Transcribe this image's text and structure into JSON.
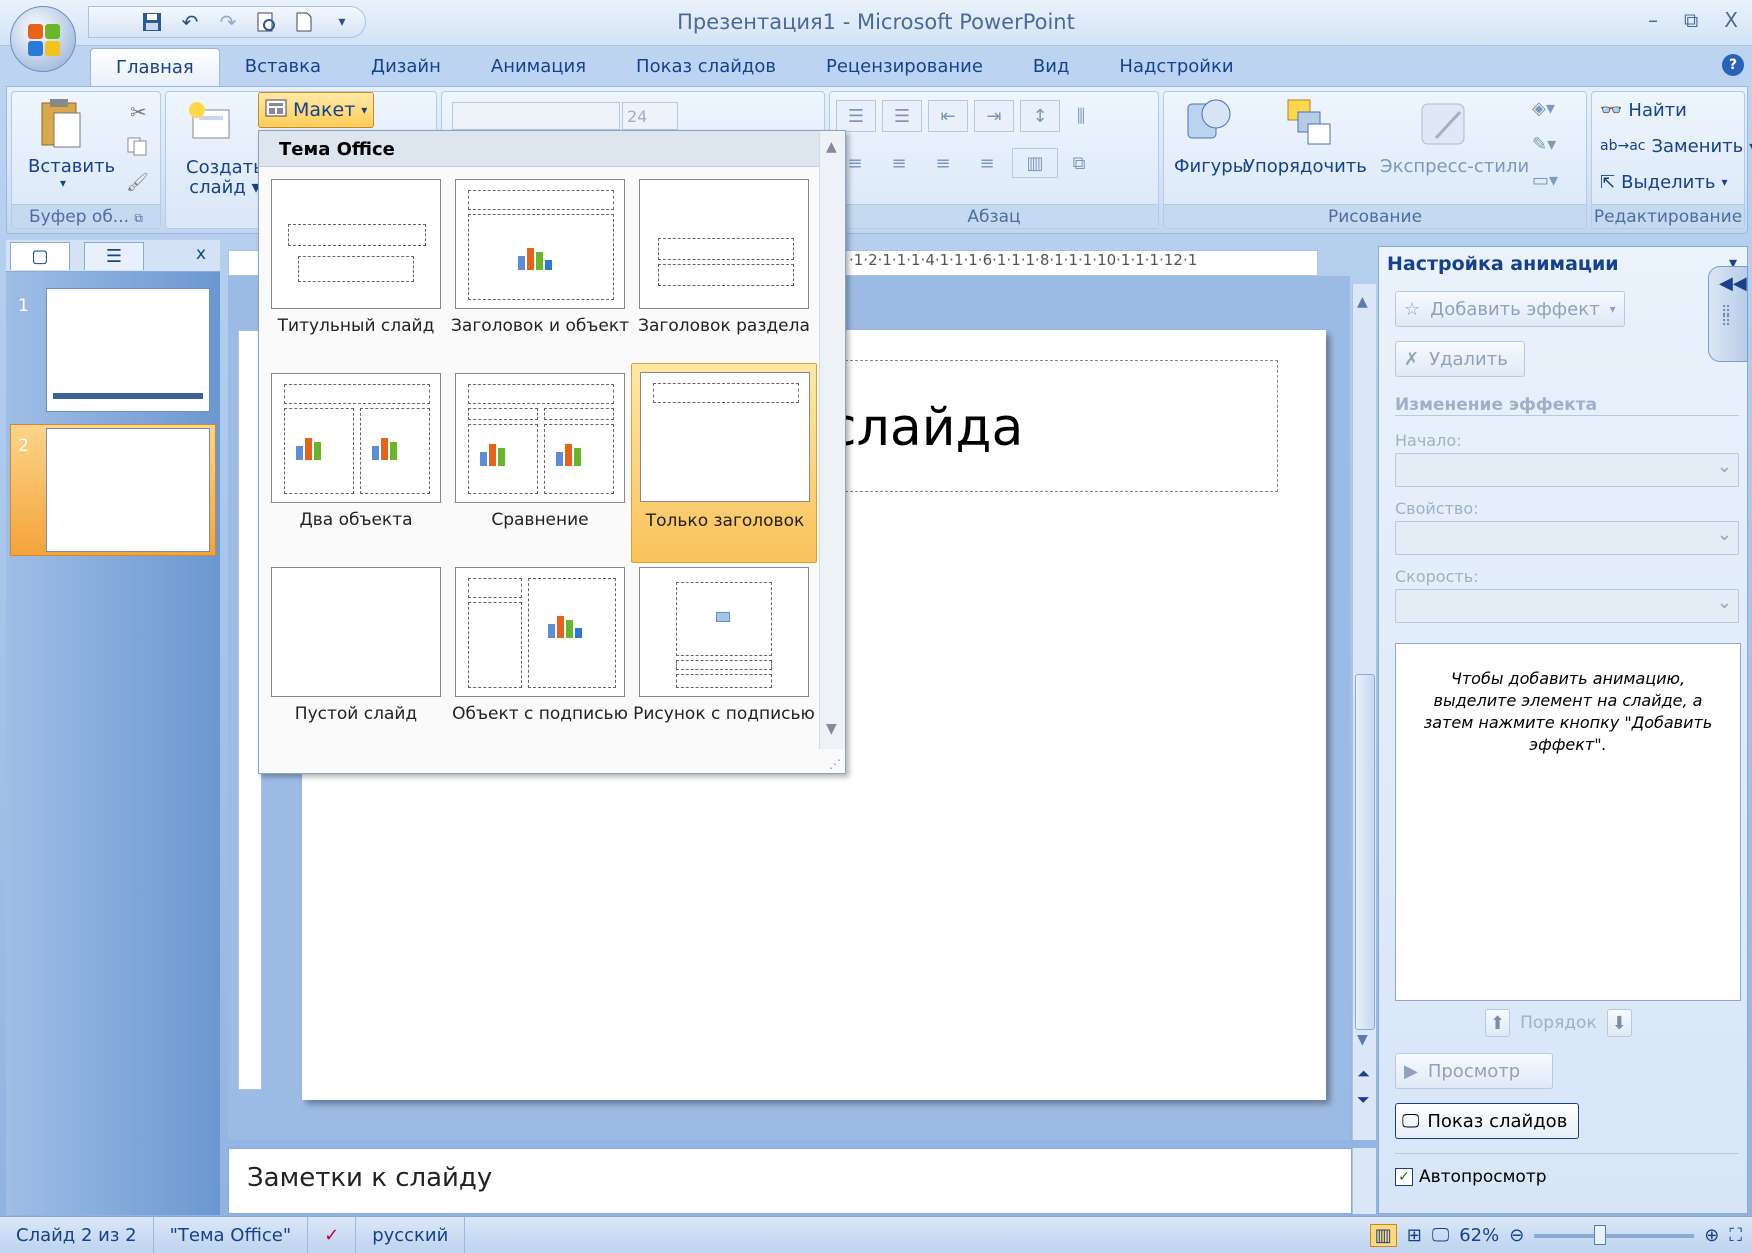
{
  "window": {
    "title": "Презентация1 - Microsoft PowerPoint",
    "min": "–",
    "max": "⧉",
    "close": "X"
  },
  "tabs": [
    "Главная",
    "Вставка",
    "Дизайн",
    "Анимация",
    "Показ слайдов",
    "Рецензирование",
    "Вид",
    "Надстройки"
  ],
  "ribbon": {
    "clipboard": {
      "paste": "Вставить",
      "label": "Буфер об..."
    },
    "slides": {
      "new_slide_1": "Создать",
      "new_slide_2": "слайд",
      "layout": "Макет"
    },
    "font_size": "24",
    "paragraph_label": "Абзац",
    "drawing": {
      "shapes": "Фигуры",
      "arrange": "Упорядочить",
      "quick_styles": "Экспресс-стили",
      "label": "Рисование"
    },
    "editing": {
      "find": "Найти",
      "replace": "Заменить",
      "select": "Выделить",
      "label": "Редактирование"
    }
  },
  "layout_gallery": {
    "header": "Тема Office",
    "items": [
      {
        "label": "Титульный слайд",
        "selected": false
      },
      {
        "label": "Заголовок и объект",
        "selected": false
      },
      {
        "label": "Заголовок раздела",
        "selected": false
      },
      {
        "label": "Два объекта",
        "selected": false
      },
      {
        "label": "Сравнение",
        "selected": false
      },
      {
        "label": "Только заголовок",
        "selected": true
      },
      {
        "label": "Пустой слайд",
        "selected": false
      },
      {
        "label": "Объект с подписью",
        "selected": false
      },
      {
        "label": "Рисунок с подписью",
        "selected": false
      }
    ]
  },
  "slides_panel": {
    "slides": [
      {
        "number": "1"
      },
      {
        "number": "2",
        "selected": true
      }
    ],
    "close": "x"
  },
  "ruler": {
    "top": "·1·2·1·1·1·4·1·1·1·6·1·1·1·8·1·1·1·10·1·1·1·12·1"
  },
  "slide": {
    "title_text": "слайда"
  },
  "notes": {
    "placeholder": "Заметки к слайду"
  },
  "animation_pane": {
    "title": "Настройка анимации",
    "add_effect": "Добавить эффект",
    "remove": "Удалить",
    "change_effect": "Изменение эффекта",
    "start": "Начало:",
    "property": "Свойство:",
    "speed": "Скорость:",
    "hint": "Чтобы добавить анимацию, выделите элемент на слайде, а затем нажмите кнопку \"Добавить эффект\".",
    "order": "Порядок",
    "preview": "Просмотр",
    "slideshow": "Показ слайдов",
    "autopreview": "Автопросмотр",
    "autopreview_checked": true
  },
  "statusbar": {
    "slide": "Слайд 2 из 2",
    "theme": "\"Тема Office\"",
    "language": "русский",
    "zoom": "62%"
  }
}
